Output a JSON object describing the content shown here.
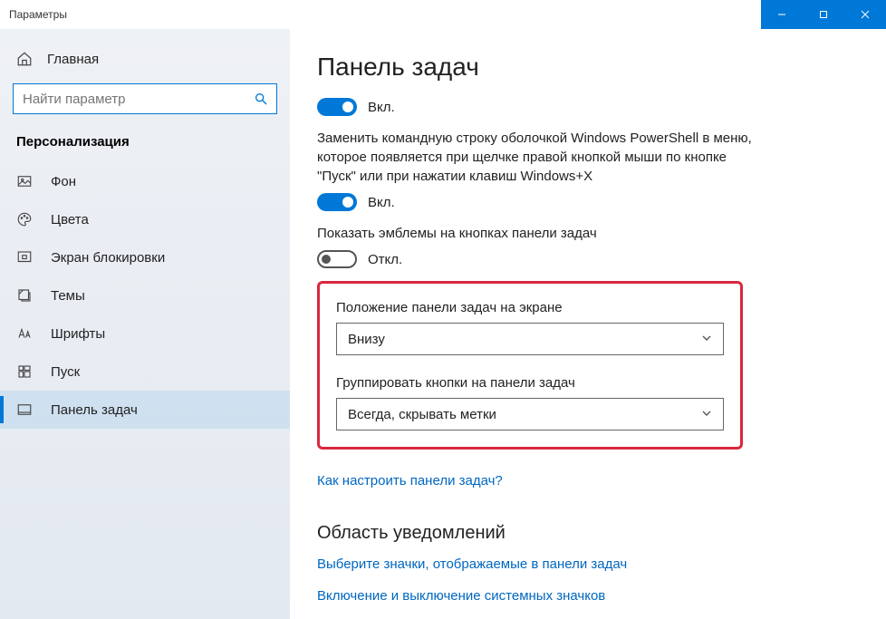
{
  "window": {
    "title": "Параметры"
  },
  "sidebar": {
    "home": "Главная",
    "search_placeholder": "Найти параметр",
    "section": "Персонализация",
    "items": [
      {
        "label": "Фон"
      },
      {
        "label": "Цвета"
      },
      {
        "label": "Экран блокировки"
      },
      {
        "label": "Темы"
      },
      {
        "label": "Шрифты"
      },
      {
        "label": "Пуск"
      },
      {
        "label": "Панель задач"
      }
    ]
  },
  "main": {
    "title": "Панель задач",
    "toggle1": {
      "state": "Вкл."
    },
    "desc2": "Заменить командную строку оболочкой Windows PowerShell в меню, которое появляется при щелчке правой кнопкой мыши по кнопке \"Пуск\" или при нажатии клавиш Windows+X",
    "toggle2": {
      "state": "Вкл."
    },
    "desc3": "Показать эмблемы на кнопках панели задач",
    "toggle3": {
      "state": "Откл."
    },
    "position_label": "Положение панели задач на экране",
    "position_value": "Внизу",
    "group_label": "Группировать кнопки на панели задач",
    "group_value": "Всегда, скрывать метки",
    "help_link": "Как настроить панели задач?",
    "notif_heading": "Область уведомлений",
    "notif_link1": "Выберите значки, отображаемые в панели задач",
    "notif_link2": "Включение и выключение системных значков"
  }
}
